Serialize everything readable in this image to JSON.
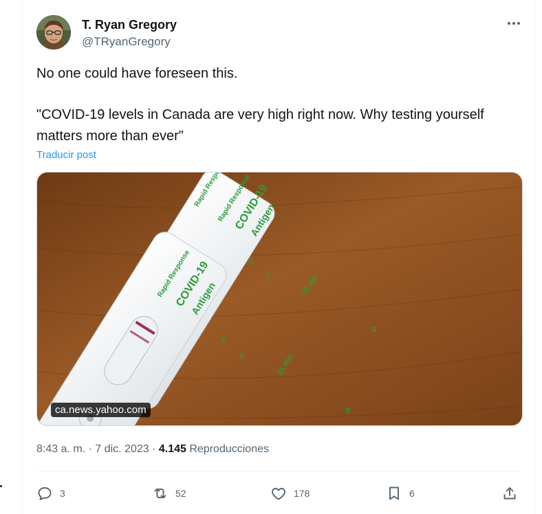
{
  "author": {
    "name": "T. Ryan Gregory",
    "handle": "@TRyanGregory"
  },
  "post": {
    "line1": "No one could have foreseen this.",
    "line2": "\"COVID-19 levels in Canada are very high right now. Why testing yourself matters more than ever\"",
    "translate_label": "Traducir post"
  },
  "media": {
    "source_label": "ca.news.yahoo.com",
    "test_brand": "Rapid Response",
    "test_title_1": "COVID-19",
    "test_title_2": "Antigen",
    "control_mark": "C",
    "test_mark": "T",
    "time_mark": "15 min",
    "sample_mark": "S"
  },
  "meta": {
    "time": "8:43 a. m.",
    "separator": " · ",
    "date": "7 dic. 2023",
    "views_count": "4.145",
    "views_label": "Reproducciones"
  },
  "actions": {
    "replies": "3",
    "reposts": "52",
    "likes": "178",
    "bookmarks": "6"
  },
  "colors": {
    "accent": "#1d9bf0",
    "text_primary": "#0f1419",
    "text_secondary": "#536471",
    "test_green": "#2a9d3a",
    "wood": "#8a4a1e"
  },
  "icons": [
    "more-icon",
    "reply-icon",
    "repost-icon",
    "like-icon",
    "bookmark-icon",
    "share-icon"
  ]
}
